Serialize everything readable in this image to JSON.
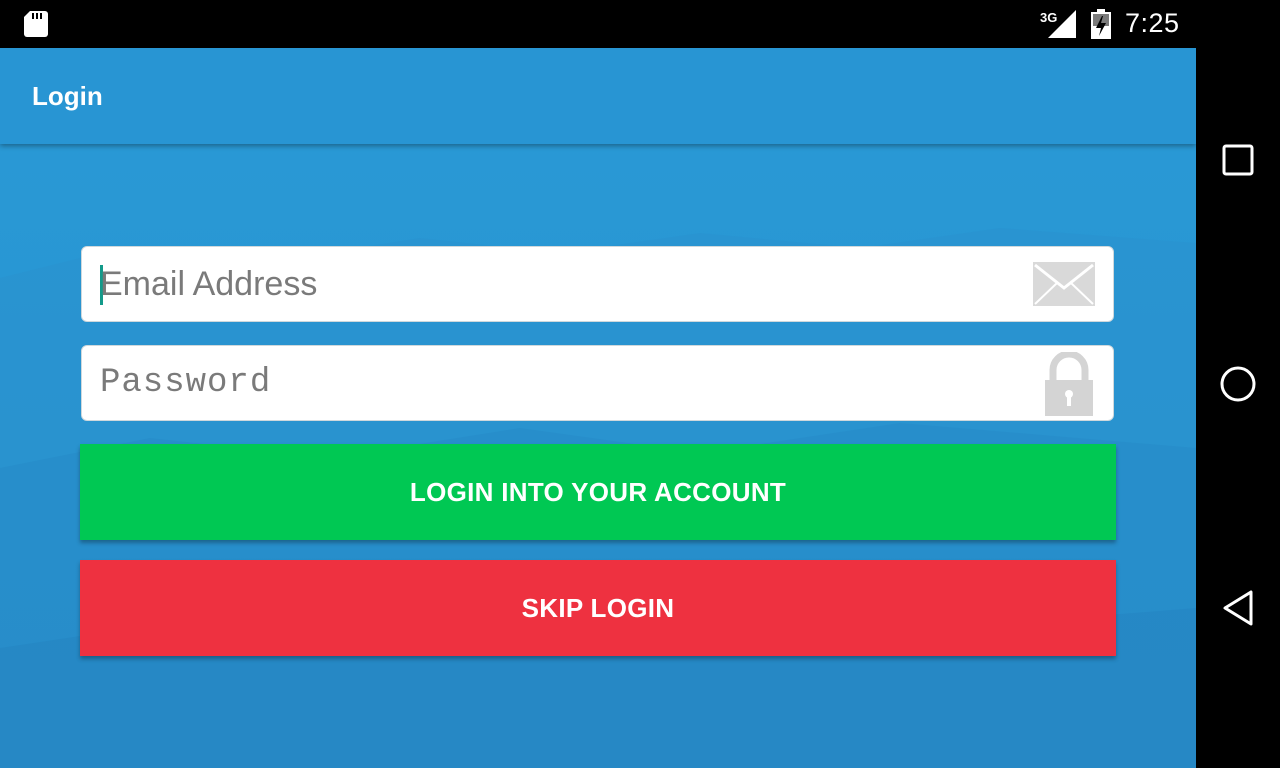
{
  "status_bar": {
    "network_label": "3G",
    "time": "7:25",
    "icons": [
      "sd-card-icon",
      "cell-signal-icon",
      "battery-charging-icon"
    ]
  },
  "toolbar": {
    "title": "Login"
  },
  "form": {
    "email": {
      "placeholder": "Email Address",
      "value": "",
      "icon": "envelope-icon"
    },
    "password": {
      "placeholder": "Password",
      "value": "",
      "icon": "lock-icon"
    },
    "login_button": "LOGIN INTO YOUR ACCOUNT",
    "skip_button": "SKIP LOGIN"
  },
  "nav_bar": {
    "buttons": [
      "recents-icon",
      "home-icon",
      "back-icon"
    ]
  },
  "colors": {
    "app_bar": "#2895d3",
    "background": "#2a9ad6",
    "login_button": "#00c853",
    "skip_button": "#ee3140",
    "cursor": "#139a8a"
  }
}
